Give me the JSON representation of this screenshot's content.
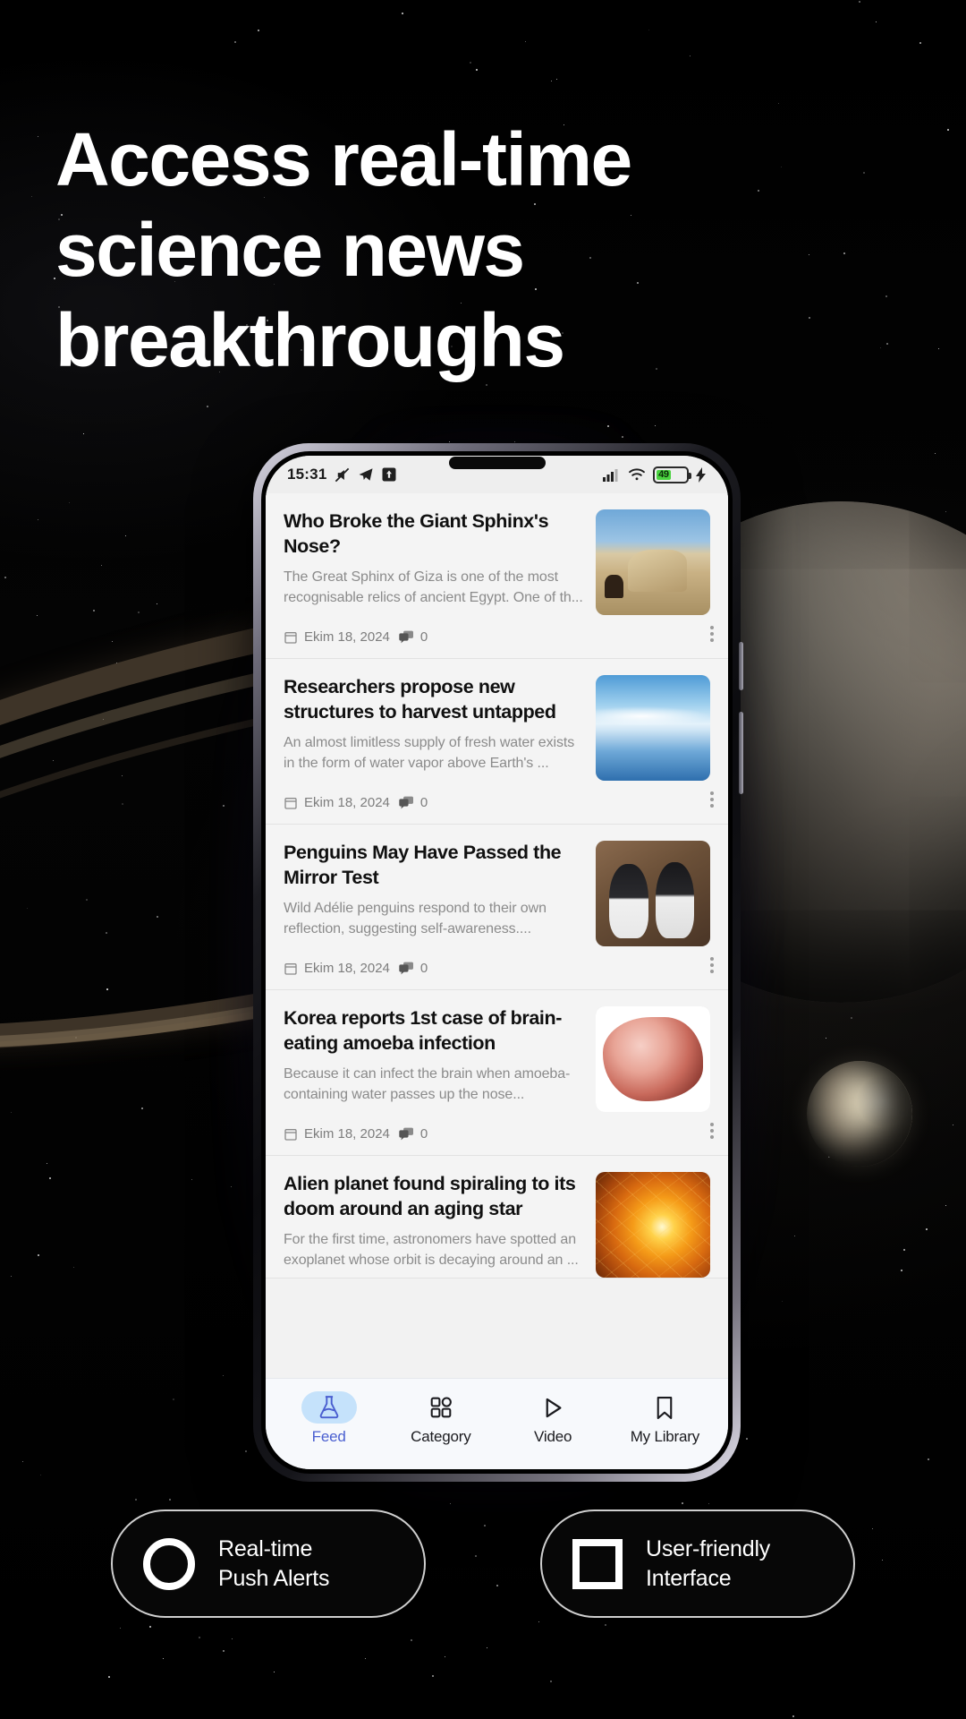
{
  "headline": {
    "lines": [
      "Access real-time",
      "science news",
      "breakthroughs"
    ]
  },
  "colors": {
    "accent_blue": "#4a5fd0",
    "active_pill": "#c5e2fb",
    "battery_green": "#4ad33f",
    "screen_bg": "#f2f2f2",
    "pill_border": "#cfcfcf"
  },
  "phone": {
    "status_bar": {
      "time": "15:31",
      "left_icons": [
        "mute-icon",
        "telegram-icon",
        "upload-icon"
      ],
      "right_icons": [
        "signal-icon",
        "wifi-icon",
        "battery-icon",
        "charging-bolt-icon"
      ],
      "battery_percent": "49"
    },
    "feed": {
      "cards": [
        {
          "title": "Who Broke the Giant Sphinx's Nose?",
          "desc": "The Great Sphinx of Giza is one of the most recognisable relics of ancient Egypt. One of th...",
          "date": "Ekim 18, 2024",
          "comments": "0",
          "image": "sphinx-thumbnail"
        },
        {
          "title": "Researchers propose new structures to harvest untapped",
          "desc": "An almost limitless supply of fresh water exists in the form of water vapor above Earth's ...",
          "date": "Ekim 18, 2024",
          "comments": "0",
          "image": "ocean-sky-thumbnail"
        },
        {
          "title": "Penguins May Have Passed the Mirror Test",
          "desc": "Wild Adélie penguins respond to their own reflection, suggesting self-awareness....",
          "date": "Ekim 18, 2024",
          "comments": "0",
          "image": "penguin-mirror-thumbnail"
        },
        {
          "title": "Korea reports 1st case of brain-eating amoeba infection",
          "desc": "Because it can infect the brain when amoeba-containing water passes up the nose...",
          "date": "Ekim 18, 2024",
          "comments": "0",
          "image": "amoeba-thumbnail"
        },
        {
          "title": "Alien planet found spiraling to its doom around an aging star",
          "desc": "For the first time, astronomers have spotted an exoplanet whose orbit is decaying around an ...",
          "date": "",
          "comments": "",
          "image": "star-flare-thumbnail"
        }
      ]
    },
    "navbar": {
      "items": [
        {
          "label": "Feed",
          "icon": "flask-icon",
          "active": true
        },
        {
          "label": "Category",
          "icon": "grid-icon",
          "active": false
        },
        {
          "label": "Video",
          "icon": "play-icon",
          "active": false
        },
        {
          "label": "My Library",
          "icon": "bookmark-icon",
          "active": false
        }
      ]
    }
  },
  "feature_pills": [
    {
      "icon": "circle-outline-icon",
      "line1": "Real-time",
      "line2": "Push Alerts"
    },
    {
      "icon": "square-outline-icon",
      "line1": "User-friendly",
      "line2": "Interface"
    }
  ]
}
